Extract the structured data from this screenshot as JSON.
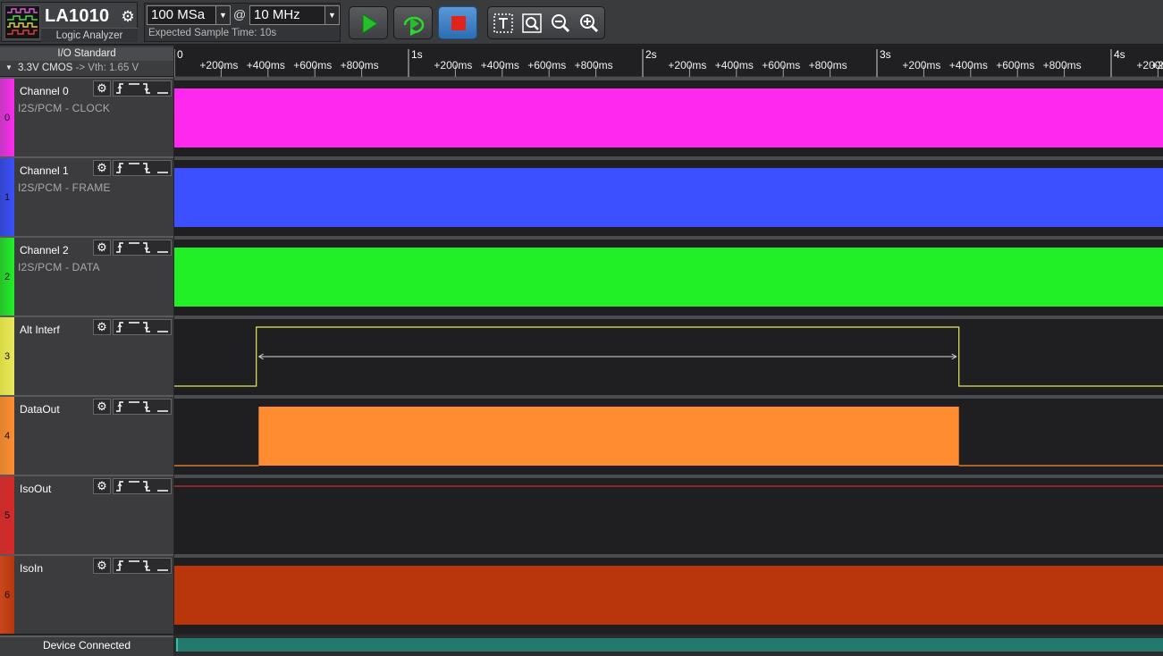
{
  "app": {
    "name": "LA1010",
    "subtitle": "Logic Analyzer",
    "gear_icon": "gear-icon"
  },
  "sampling": {
    "depth": "100 MSa",
    "at": "@",
    "rate": "10 MHz",
    "expected_time": "Expected Sample Time: 10s"
  },
  "controls": {
    "start_icon": "play-icon",
    "repeat_icon": "repeat-run-icon",
    "stop_icon": "stop-icon",
    "text_icon": "text-cursor-icon",
    "zoom_fit_icon": "zoom-fit-icon",
    "zoom_out_icon": "zoom-out-icon",
    "zoom_in_icon": "zoom-in-icon"
  },
  "io": {
    "title": "I/O Standard",
    "standard": "3.3V CMOS",
    "vth": "-> Vth: 1.65 V"
  },
  "ruler": {
    "majors": [
      "0",
      "1s",
      "2s",
      "3s",
      "4s"
    ],
    "minors": [
      "+200ms",
      "+400ms",
      "+600ms",
      "+800ms"
    ],
    "trailing": "+2"
  },
  "channels": [
    {
      "index": "0",
      "name": "Channel 0",
      "protocol": "I2S/PCM - CLOCK",
      "color": "#ff28ef",
      "stripe": "#c238c2",
      "signal": "dense",
      "fill_start": 0.0,
      "fill_end": 1.0
    },
    {
      "index": "1",
      "name": "Channel 1",
      "protocol": "I2S/PCM - FRAME",
      "color": "#3c50ff",
      "stripe": "#3245c9",
      "signal": "dense",
      "fill_start": 0.0,
      "fill_end": 1.0
    },
    {
      "index": "2",
      "name": "Channel 2",
      "protocol": "I2S/PCM - DATA",
      "color": "#21f027",
      "stripe": "#27c02b",
      "signal": "dense",
      "fill_start": 0.0,
      "fill_end": 1.0
    },
    {
      "index": "3",
      "name": "Alt Interf",
      "protocol": "",
      "color": "#e8e85c",
      "stripe": "#d9d946",
      "signal": "pulse",
      "pulse_start_s": 0.35,
      "pulse_end_s": 3.35
    },
    {
      "index": "4",
      "name": "DataOut",
      "protocol": "",
      "color": "#ff8c30",
      "stripe": "#e0832f",
      "signal": "burst",
      "pulse_start_s": 0.36,
      "pulse_end_s": 3.35
    },
    {
      "index": "5",
      "name": "IsoOut",
      "protocol": "",
      "color": "#d42a2a",
      "stripe": "#c92c2c",
      "signal": "high-line"
    },
    {
      "index": "6",
      "name": "IsoIn",
      "protocol": "",
      "color": "#b9360c",
      "stripe": "#c8471c",
      "signal": "dense",
      "fill_start": 0.0,
      "fill_end": 1.0
    }
  ],
  "status": {
    "text": "Device Connected"
  }
}
